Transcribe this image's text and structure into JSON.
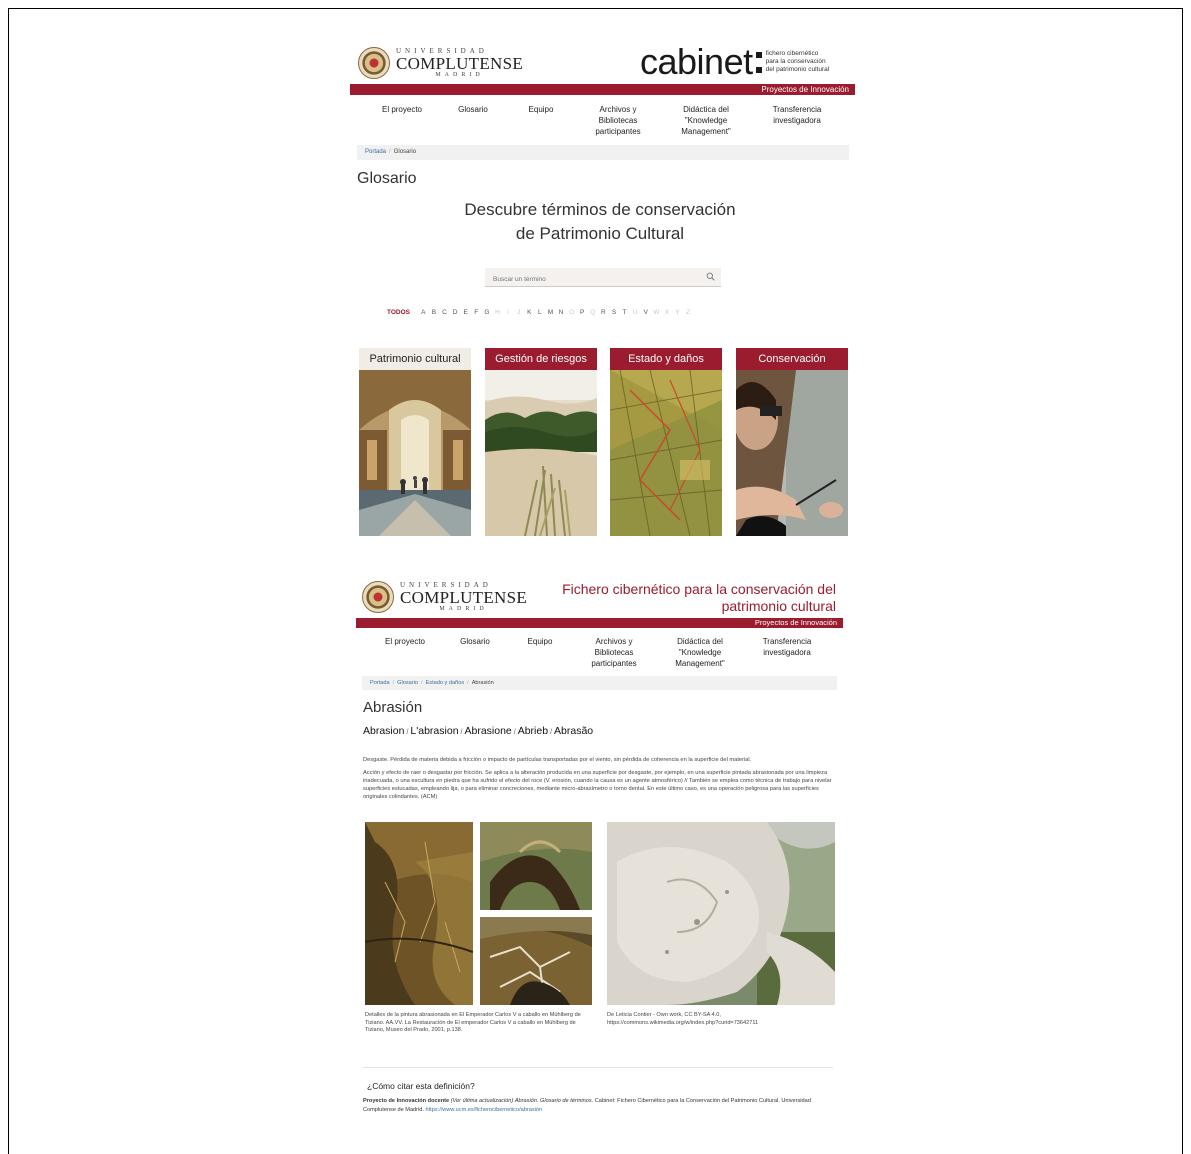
{
  "header1": {
    "ucm_top": "UNIVERSIDAD",
    "ucm_main": "COMPLUTENSE",
    "ucm_bottom": "MADRID",
    "brand": "cabinet",
    "tagline": [
      "fichero cibernético",
      "para la conservación",
      "del patrimonio cultural"
    ],
    "bar_label": "Proyectos de Innovación"
  },
  "nav": [
    {
      "label": "El proyecto"
    },
    {
      "label": "Glosario"
    },
    {
      "label": "Equipo"
    },
    {
      "label": "Archivos y Bibliotecas participantes"
    },
    {
      "label": "Didáctica del \"Knowledge Management\""
    },
    {
      "label": "Transferencia investigadora"
    }
  ],
  "page1": {
    "breadcrumb": {
      "home": "Portada",
      "current": "Glosario"
    },
    "title": "Glosario",
    "subtitle_line1": "Descubre términos de conservación",
    "subtitle_line2": "de Patrimonio Cultural",
    "search_placeholder": "Buscar un término",
    "alphabet_all": "TODOS",
    "letters": [
      "A",
      "B",
      "C",
      "D",
      "E",
      "F",
      "G",
      "H",
      "I",
      "J",
      "K",
      "L",
      "M",
      "N",
      "O",
      "P",
      "Q",
      "R",
      "S",
      "T",
      "U",
      "V",
      "W",
      "X",
      "Y",
      "Z"
    ],
    "disabled_letters": [
      "H",
      "I",
      "J",
      "O",
      "Q",
      "U",
      "W",
      "X",
      "Y",
      "Z"
    ],
    "categories": [
      {
        "label": "Patrimonio cultural",
        "image": "gallery-hall-photo"
      },
      {
        "label": "Gestión de riesgos",
        "image": "dunes-photo"
      },
      {
        "label": "Estado y daños",
        "image": "old-map-photo"
      },
      {
        "label": "Conservación",
        "image": "restorer-photo"
      }
    ]
  },
  "header2": {
    "title_line1": "Fichero cibernético para la conservación del",
    "title_line2": "patrimonio cultural",
    "bar_label": "Proyectos de Innovación"
  },
  "page2": {
    "breadcrumb": {
      "home": "Portada",
      "glosario": "Glosario",
      "cat": "Estado y daños",
      "current": "Abrasión"
    },
    "title": "Abrasión",
    "translations": [
      "Abrasion",
      "L'abrasion",
      "Abrasione",
      "Abrieb",
      "Abrasão"
    ],
    "desc1": "Desgaste. Pérdida de materia debida a fricción o impacto de partículas transportadas por el viento, sin pérdida de coherencia en la superficie del material.",
    "desc2": "Acción y efecto de raer o desgastar por fricción. Se aplica a la alteración producida en una superficie por desgaste, por ejemplo, en una superficie pintada abrasionada por una limpieza inadecuada, o una escultura en piedra que ha sufrido el efecto del roce (V. erosión, cuando la causa es un agente atmosférico) // También se emplea como técnica de trabajo para nivelar superficies estucadas, empleando lija, o para eliminar concreciones, mediante micro-abrasímetro o torno dental. En este último caso, es una operación peligrosa para las superficies originales colindantes. (ACM)",
    "caption1": "Detalles de la pintura abrasionada en El Emperador Carlos V a caballo en Mühlberg de Tiziano. AA.VV. La Restauración de El emperador Carlos V a caballo en Mühlberg de Tiziano, Museo del Prado, 2001, p.138.",
    "caption2_line1": "De Leticia Contier - Own work, CC BY-SA 4.0,",
    "caption2_line2": "https://commons.wikimedia.org/w/index.php?curid=73642711",
    "cite_heading": "¿Cómo citar esta definición?",
    "cite_bold": "Proyecto de Innovación docente",
    "cite_italic1": "(Ver última actualización)",
    "cite_term": "Abrasión.",
    "cite_italic2": "Glosario de términos.",
    "cite_rest": "Cabinet: Fichero Cibernético para la Conservación del Patrimonio Cultural. Universidad Complutense de Madrid.",
    "cite_link": "https://www.ucm.es/ficherocibernetico/abrasión"
  },
  "colors": {
    "accent": "#9b1c2e",
    "link": "#3a6ea5",
    "breadcrumb_bg": "#f1f1f1"
  }
}
